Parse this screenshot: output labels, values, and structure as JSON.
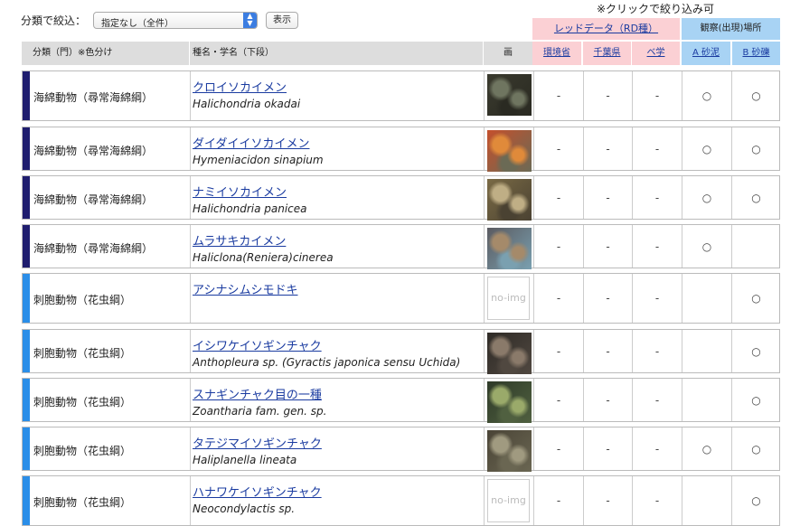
{
  "filter": {
    "label": "分類で絞込：",
    "selected": "指定なし（全件）",
    "button": "表示"
  },
  "note": "※クリックで絞り込み可",
  "groups": {
    "red_data": "レッドデータ（RD種）",
    "observation": "観察(出現)場所"
  },
  "headers": {
    "category": "分類（門）※色分け",
    "name": "種名・学名（下段）",
    "image": "画",
    "env": "環境省",
    "chiba": "千葉県",
    "benthos": "ベ学",
    "a": "A 砂泥",
    "b": "B 砂礫"
  },
  "colors": {
    "sponge": "#1f1d6e",
    "cnidaria": "#2b8ee8",
    "pink": "#fbd0d4",
    "blue": "#a8d3f4"
  },
  "rows": [
    {
      "category": "海綿動物（尋常海綿綱）",
      "stripe": "sponge",
      "jname": "クロイソカイメン",
      "sname": "Halichondria okadai",
      "image": "photo",
      "env": "-",
      "chiba": "-",
      "benthos": "-",
      "a": "○",
      "b": "○"
    },
    {
      "category": "海綿動物（尋常海綿綱）",
      "stripe": "sponge",
      "jname": "ダイダイイソカイメン",
      "sname": "Hymeniacidon sinapium",
      "image": "photo",
      "env": "-",
      "chiba": "-",
      "benthos": "-",
      "a": "○",
      "b": "○"
    },
    {
      "category": "海綿動物（尋常海綿綱）",
      "stripe": "sponge",
      "jname": "ナミイソカイメン",
      "sname": "Halichondria panicea",
      "image": "photo",
      "env": "-",
      "chiba": "-",
      "benthos": "-",
      "a": "○",
      "b": "○"
    },
    {
      "category": "海綿動物（尋常海綿綱）",
      "stripe": "sponge",
      "jname": "ムラサキカイメン",
      "sname": "Haliclona(Reniera)cinerea",
      "image": "photo",
      "env": "-",
      "chiba": "-",
      "benthos": "-",
      "a": "○",
      "b": ""
    },
    {
      "category": "刺胞動物（花虫綱）",
      "stripe": "cnidaria",
      "jname": "アシナシムシモドキ",
      "sname": "",
      "image": "no-img",
      "env": "-",
      "chiba": "-",
      "benthos": "-",
      "a": "",
      "b": "○"
    },
    {
      "category": "刺胞動物（花虫綱）",
      "stripe": "cnidaria",
      "jname": "イシワケイソギンチャク",
      "sname": "Anthopleura sp. (Gyractis japonica sensu Uchida)",
      "image": "photo",
      "env": "-",
      "chiba": "-",
      "benthos": "-",
      "a": "",
      "b": "○"
    },
    {
      "category": "刺胞動物（花虫綱）",
      "stripe": "cnidaria",
      "jname": "スナギンチャク目の一種",
      "sname": "Zoantharia fam. gen. sp.",
      "image": "photo",
      "env": "-",
      "chiba": "-",
      "benthos": "-",
      "a": "",
      "b": "○"
    },
    {
      "category": "刺胞動物（花虫綱）",
      "stripe": "cnidaria",
      "jname": "タテジマイソギンチャク",
      "sname": "Haliplanella lineata",
      "image": "photo",
      "env": "-",
      "chiba": "-",
      "benthos": "-",
      "a": "○",
      "b": "○"
    },
    {
      "category": "刺胞動物（花虫綱）",
      "stripe": "cnidaria",
      "jname": "ハナワケイソギンチャク",
      "sname": "Neocondylactis sp.",
      "image": "no-img",
      "env": "-",
      "chiba": "-",
      "benthos": "-",
      "a": "",
      "b": "○"
    }
  ],
  "noimg_text": "no-img"
}
